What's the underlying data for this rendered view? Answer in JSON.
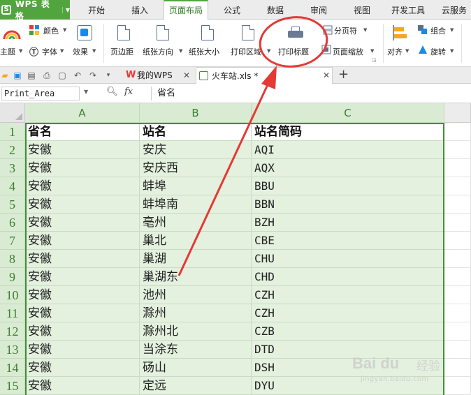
{
  "app": {
    "logo": "S",
    "name": "WPS 表格"
  },
  "menu": {
    "tabs": [
      "开始",
      "插入",
      "页面布局",
      "公式",
      "数据",
      "审阅",
      "视图",
      "开发工具",
      "云服务"
    ],
    "active": "页面布局"
  },
  "ribbon": {
    "theme_label": "主题",
    "colors_label": "颜色",
    "fonts_label": "字体",
    "effects_label": "效果",
    "margins_label": "页边距",
    "orientation_label": "纸张方向",
    "size_label": "纸张大小",
    "print_area_label": "打印区域",
    "print_titles_label": "打印标题",
    "breaks_label": "分页符",
    "scale_label": "页面缩放",
    "align_label": "对齐",
    "group_label": "组合",
    "rotate_label": "旋转"
  },
  "tabs": {
    "home_tab": "我的WPS",
    "file_tab": "火车站.xls *"
  },
  "formula_bar": {
    "name_box": "Print_Area",
    "fx": "fx",
    "content": "省名"
  },
  "sheet": {
    "columns": [
      "A",
      "B",
      "C"
    ],
    "rows": [
      {
        "n": "1",
        "a": "省名",
        "b": "站名",
        "c": "站名简码"
      },
      {
        "n": "2",
        "a": "安徽",
        "b": "安庆",
        "c": "AQI"
      },
      {
        "n": "3",
        "a": "安徽",
        "b": "安庆西",
        "c": "AQX"
      },
      {
        "n": "4",
        "a": "安徽",
        "b": "蚌埠",
        "c": "BBU"
      },
      {
        "n": "5",
        "a": "安徽",
        "b": "蚌埠南",
        "c": "BBN"
      },
      {
        "n": "6",
        "a": "安徽",
        "b": "亳州",
        "c": "BZH"
      },
      {
        "n": "7",
        "a": "安徽",
        "b": "巢北",
        "c": "CBE"
      },
      {
        "n": "8",
        "a": "安徽",
        "b": "巢湖",
        "c": "CHU"
      },
      {
        "n": "9",
        "a": "安徽",
        "b": "巢湖东",
        "c": "CHD"
      },
      {
        "n": "10",
        "a": "安徽",
        "b": "池州",
        "c": "CZH"
      },
      {
        "n": "11",
        "a": "安徽",
        "b": "滁州",
        "c": "CZH"
      },
      {
        "n": "12",
        "a": "安徽",
        "b": "滁州北",
        "c": "CZB"
      },
      {
        "n": "13",
        "a": "安徽",
        "b": "当涂东",
        "c": "DTD"
      },
      {
        "n": "14",
        "a": "安徽",
        "b": "砀山",
        "c": "DSH"
      },
      {
        "n": "15",
        "a": "安徽",
        "b": "定远",
        "c": "DYU"
      }
    ]
  },
  "colors": {
    "accent": "#52a53e",
    "header_fill": "#d9ecd3",
    "selection_fill": "#e4f1df",
    "annotation": "#e53935"
  },
  "watermark": {
    "brand": "Bai du",
    "cn": "经验",
    "url": "jingyan.baidu.com"
  }
}
